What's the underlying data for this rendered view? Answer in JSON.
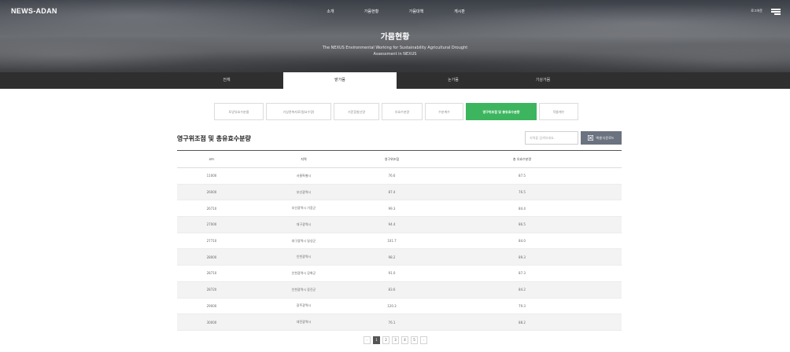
{
  "header": {
    "logo": "NEWS-ADAN",
    "nav": [
      "소개",
      "가뭄현황",
      "가뭄대책",
      "게시판"
    ],
    "login": "로그아웃",
    "menu_icon": "hamburger-menu-icon"
  },
  "hero": {
    "title": "가뭄현황",
    "subtitle_line1": "The NEXUS Environmental Working for Sustainability Agricultural Drought",
    "subtitle_line2": "Assessment in NEXUS"
  },
  "categories": [
    {
      "label": "전체",
      "active": false
    },
    {
      "label": "밭가뭄",
      "active": true
    },
    {
      "label": "논가뭄",
      "active": false
    },
    {
      "label": "기상가뭄",
      "active": false
    }
  ],
  "subtabs": [
    {
      "label": "토양유효수분율",
      "active": false
    },
    {
      "label": "기상관측자료(필요수량)",
      "active": false
    },
    {
      "label": "기준증발산량",
      "active": false
    },
    {
      "label": "유효수분량",
      "active": false
    },
    {
      "label": "수분계수",
      "active": false
    },
    {
      "label": "영구위조점 및 총유효수분량",
      "active": true
    },
    {
      "label": "작물계수",
      "active": false
    }
  ],
  "section": {
    "title": "영구위조점 및 총유효수분량",
    "search_placeholder": "지역을 검색하세요.",
    "excel_label": "엑셀 다운로드",
    "excel_icon": "excel-icon"
  },
  "table": {
    "headers": [
      "코드",
      "지역",
      "영구위조점",
      "총 유효수분량"
    ],
    "rows": [
      [
        "11000",
        "서울특별시",
        "76.6",
        "87.5"
      ],
      [
        "26000",
        "부산광역시",
        "87.4",
        "76.5"
      ],
      [
        "26710",
        "부산광역시 기장군",
        "99.3",
        "84.4"
      ],
      [
        "27000",
        "대구광역시",
        "94.4",
        "86.5"
      ],
      [
        "27710",
        "대구광역시 달성군",
        "101.7",
        "84.0"
      ],
      [
        "28000",
        "인천광역시",
        "98.2",
        "89.3"
      ],
      [
        "28710",
        "인천광역시 강화군",
        "91.0",
        "87.3"
      ],
      [
        "28720",
        "인천광역시 옹진군",
        "83.6",
        "84.2"
      ],
      [
        "29000",
        "광주광역시",
        "120.3",
        "79.3"
      ],
      [
        "30000",
        "대전광역시",
        "76.1",
        "88.2"
      ]
    ]
  },
  "pagination": {
    "prev": "‹",
    "next": "›",
    "pages": [
      "1",
      "2",
      "3",
      "4",
      "5"
    ],
    "current": "1"
  },
  "colors": {
    "accent_green": "#3cb55e",
    "dark_bar": "#2f2f2f",
    "excel_button": "#6b7280"
  }
}
